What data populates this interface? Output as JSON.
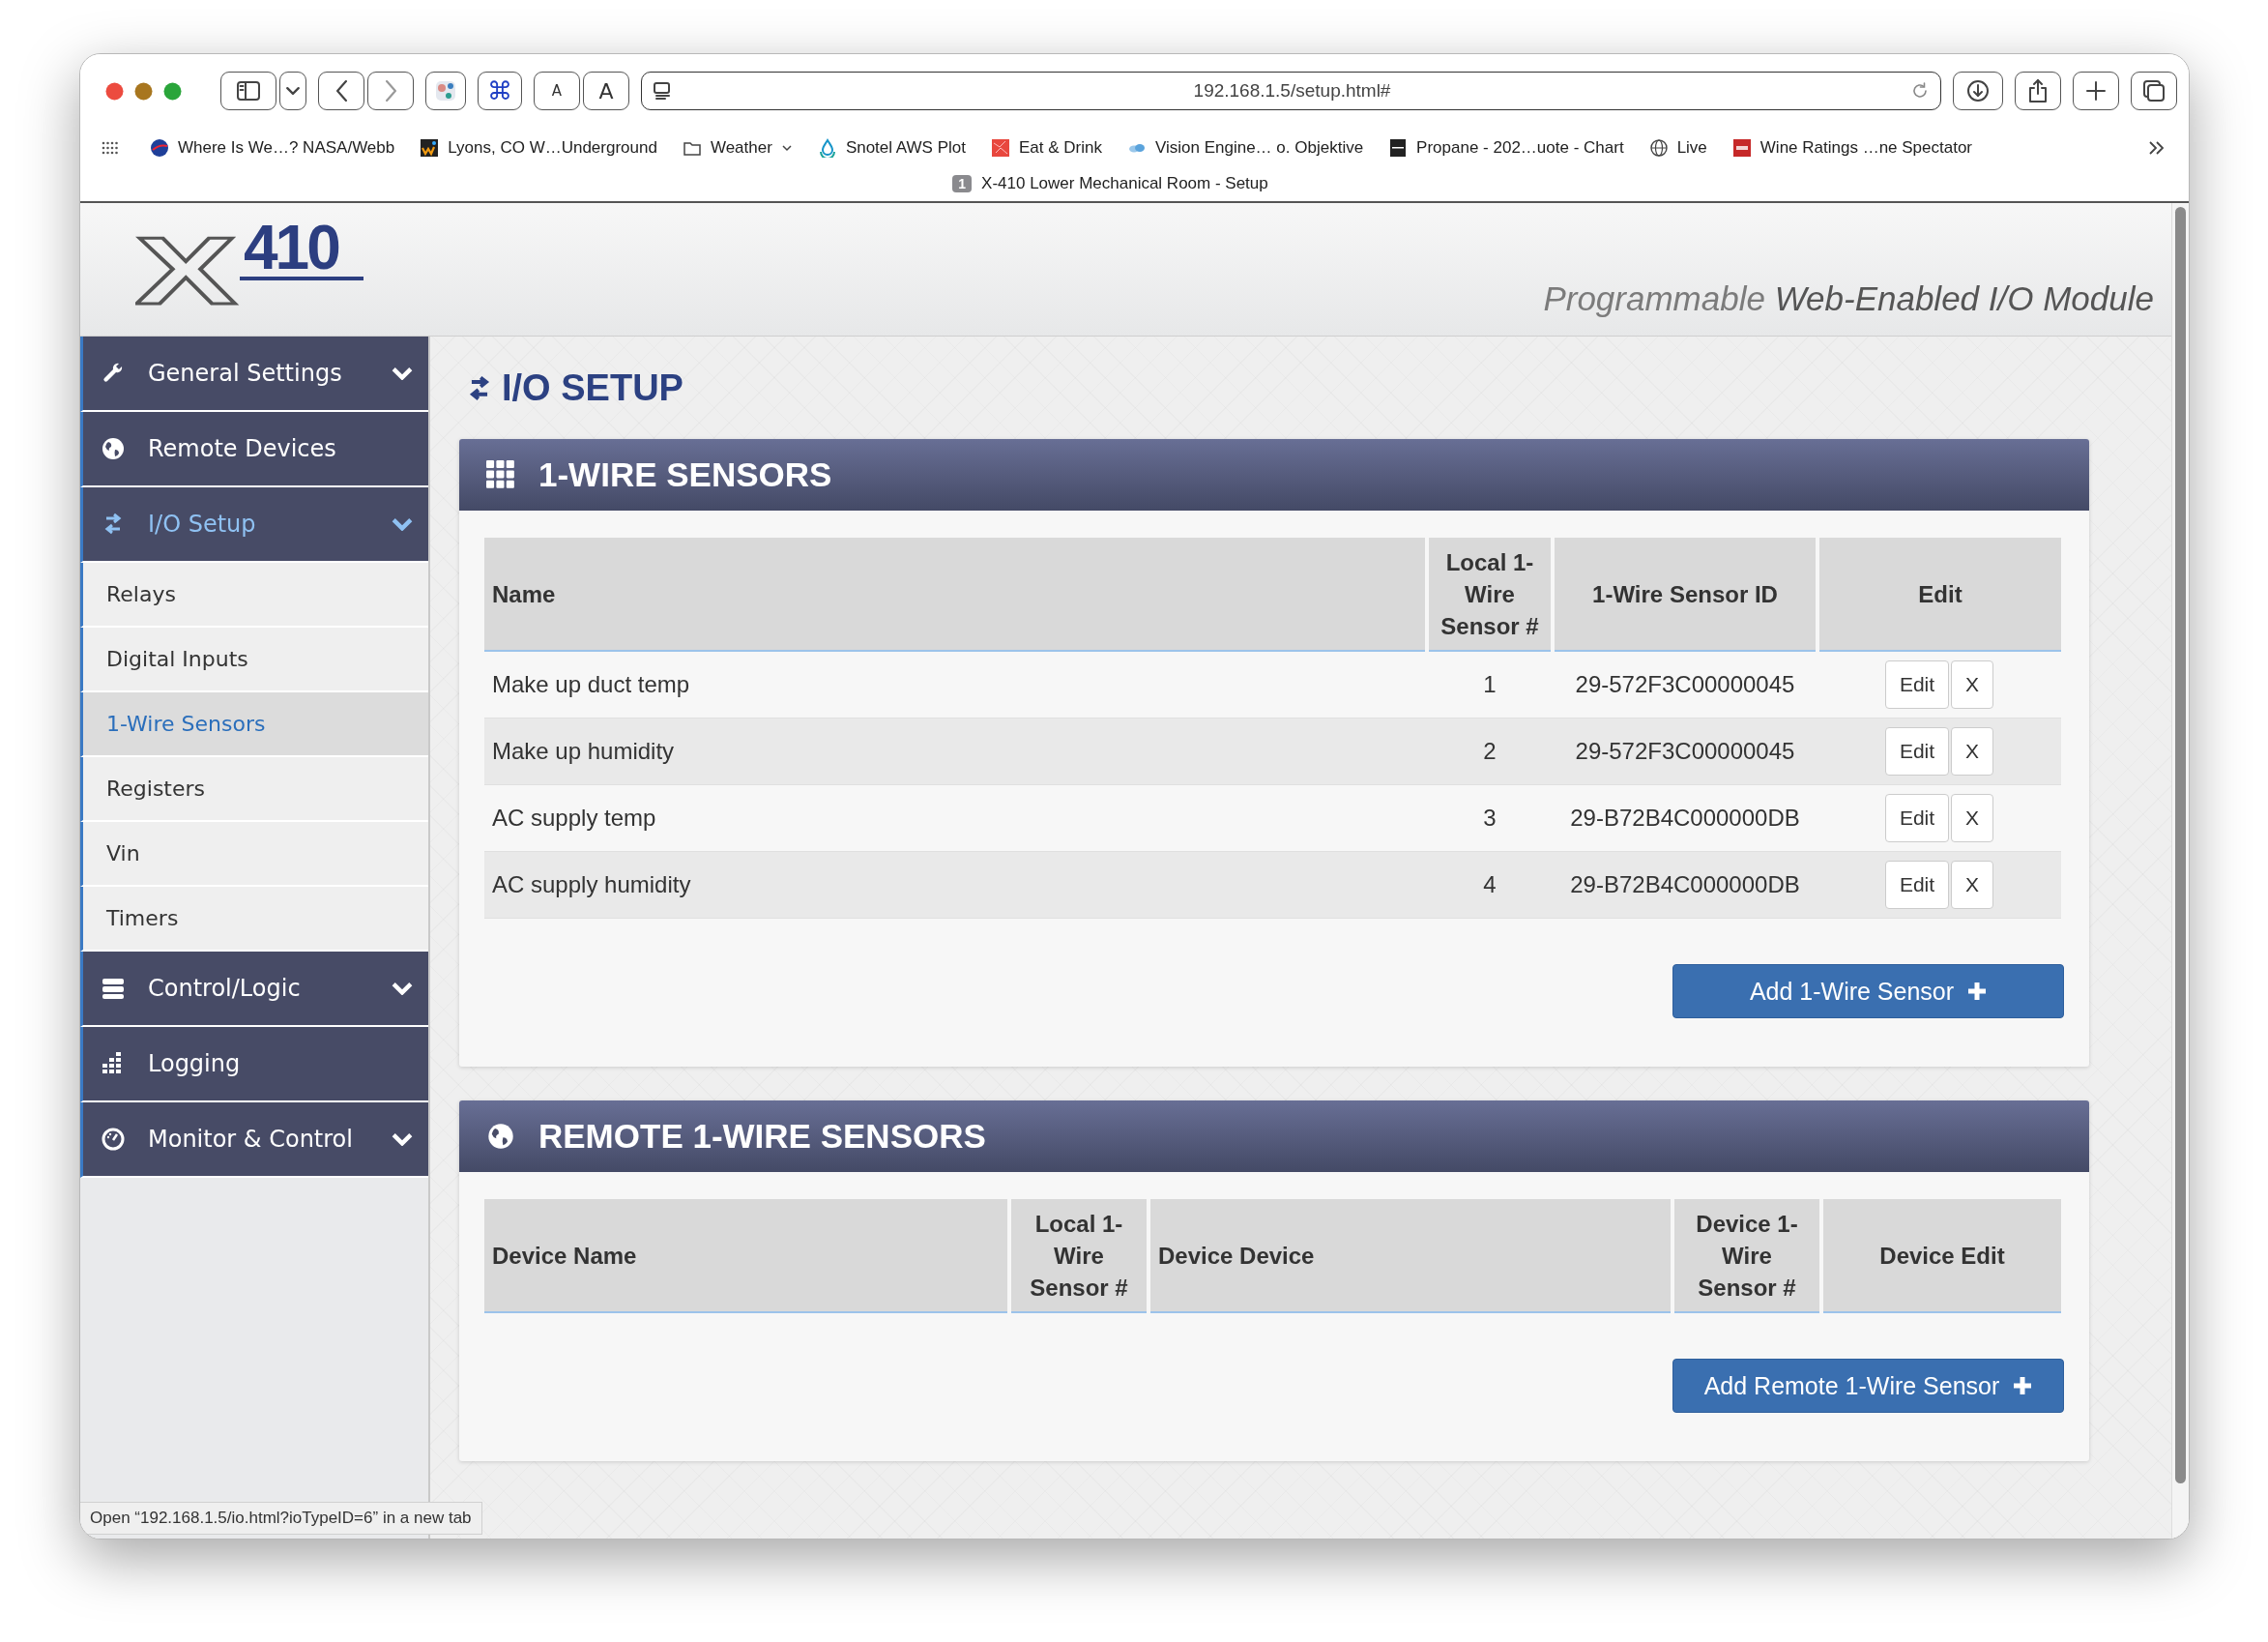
{
  "window": {
    "url": "192.168.1.5/setup.html#",
    "command_key": "⌘",
    "font_smaller": "A",
    "font_larger": "A"
  },
  "bookmarks": [
    {
      "label": "Where Is We…? NASA/Webb",
      "kind": "link"
    },
    {
      "label": "Lyons, CO W…Underground",
      "kind": "link"
    },
    {
      "label": "Weather",
      "kind": "folder"
    },
    {
      "label": "Snotel AWS Plot",
      "kind": "link"
    },
    {
      "label": "Eat & Drink",
      "kind": "link"
    },
    {
      "label": "Vision Engine… o. Objektive",
      "kind": "link"
    },
    {
      "label": "Propane - 202…uote - Chart",
      "kind": "link"
    },
    {
      "label": "Live",
      "kind": "link"
    },
    {
      "label": "Wine Ratings …ne Spectator",
      "kind": "link"
    }
  ],
  "tab": {
    "count": "1",
    "title": "X-410 Lower Mechanical Room - Setup"
  },
  "header": {
    "logo_letter": "X",
    "logo_number": "410",
    "tagline": "Programmable **Web-Enabled I/O Module**"
  },
  "sidebar": {
    "items": [
      {
        "label": "General Settings",
        "kind": "dropdown",
        "selected": false
      },
      {
        "label": "Remote Devices",
        "kind": "link",
        "selected": false
      },
      {
        "label": "I/O Setup",
        "kind": "dropdown",
        "selected": true,
        "children": [
          {
            "label": "Relays",
            "selected": false
          },
          {
            "label": "Digital Inputs",
            "selected": false
          },
          {
            "label": "1-Wire Sensors",
            "selected": true
          },
          {
            "label": "Registers",
            "selected": false
          },
          {
            "label": "Vin",
            "selected": false
          },
          {
            "label": "Timers",
            "selected": false
          }
        ]
      },
      {
        "label": "Control/Logic",
        "kind": "dropdown",
        "selected": false
      },
      {
        "label": "Logging",
        "kind": "link",
        "selected": false
      },
      {
        "label": "Monitor & Control",
        "kind": "dropdown",
        "selected": false
      }
    ]
  },
  "page_title": "I/O SETUP",
  "panels": [
    {
      "title": "1-WIRE SENSORS",
      "columns": [
        {
          "label": "Name",
          "kind": "text"
        },
        {
          "label": "Local 1-Wire Sensor #",
          "kind": "number"
        },
        {
          "label": "1-Wire Sensor ID",
          "kind": "id"
        },
        {
          "label": "Edit",
          "kind": "action"
        }
      ],
      "rows": [
        {
          "cells": [
            "Make up duct temp",
            "1",
            "29-572F3C00000045"
          ],
          "actions": [
            "Edit",
            "X"
          ]
        },
        {
          "cells": [
            "Make up humidity",
            "2",
            "29-572F3C00000045"
          ],
          "actions": [
            "Edit",
            "X"
          ]
        },
        {
          "cells": [
            "AC supply temp",
            "3",
            "29-B72B4C000000DB"
          ],
          "actions": [
            "Edit",
            "X"
          ]
        },
        {
          "cells": [
            "AC supply humidity",
            "4",
            "29-B72B4C000000DB"
          ],
          "actions": [
            "Edit",
            "X"
          ]
        }
      ],
      "button": "Add 1-Wire Sensor"
    },
    {
      "title": "REMOTE 1-WIRE SENSORS",
      "columns": [
        {
          "label": "Device Name",
          "kind": "text"
        },
        {
          "label": "Local 1-Wire Sensor #",
          "kind": "number"
        },
        {
          "label": "Device Device",
          "kind": "text"
        },
        {
          "label": "Device 1-Wire Sensor #",
          "kind": "number"
        },
        {
          "label": "Device Edit",
          "kind": "action"
        }
      ],
      "button": "Add Remote 1-Wire Sensor"
    }
  ],
  "status_bar": "Open “192.168.1.5/io.html?ioTypeID=6” in a new tab"
}
